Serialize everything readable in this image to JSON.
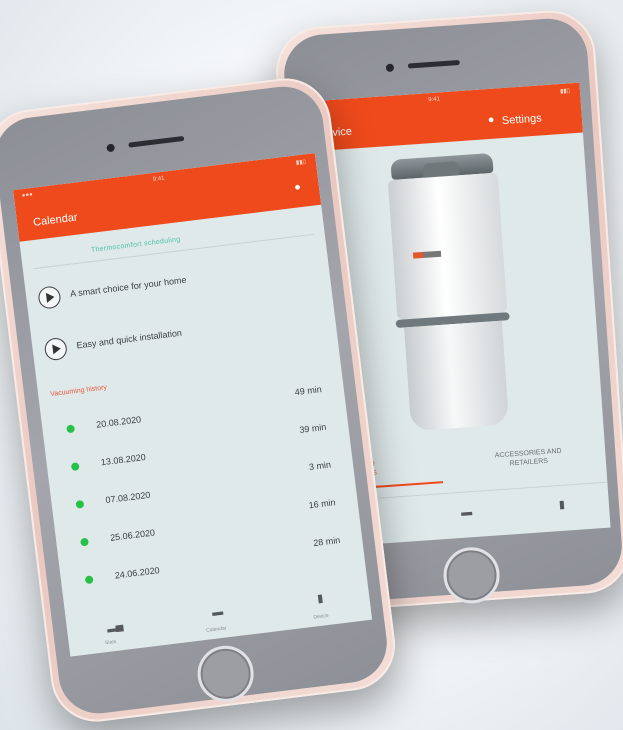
{
  "left_phone": {
    "header": {
      "title": "Calendar",
      "user_icon": "user-icon"
    },
    "section_heading": "Thermocomfort scheduling",
    "features": [
      {
        "label": "A smart choice for your home",
        "icon": "play-icon"
      },
      {
        "label": "Easy and quick installation",
        "icon": "play-icon"
      }
    ],
    "history_heading": "Vacuuming history",
    "history": [
      {
        "date": "20.08.2020",
        "duration": "49 min"
      },
      {
        "date": "13.08.2020",
        "duration": "39 min"
      },
      {
        "date": "07.08.2020",
        "duration": "3 min"
      },
      {
        "date": "25.06.2020",
        "duration": "16 min"
      },
      {
        "date": "24.06.2020",
        "duration": "28 min"
      }
    ],
    "tabs": [
      {
        "icon": "stats-icon",
        "label": "Stats"
      },
      {
        "icon": "calendar-icon",
        "label": "Calendar"
      },
      {
        "icon": "device-icon",
        "label": "Device"
      }
    ]
  },
  "right_phone": {
    "header": {
      "title": "Device",
      "settings_label": "Settings",
      "user_icon": "user-icon"
    },
    "tabs_text": {
      "guides": "GUIDES AND BROCHURES",
      "accessories": "ACCESSORIES AND RETAILERS"
    },
    "bottom_icons": [
      "stats-icon",
      "calendar-icon",
      "device-icon"
    ],
    "product_label": "central vacuum unit"
  },
  "colors": {
    "accent": "#ef4a1c",
    "status_green": "#27c14a",
    "teal_heading": "#4cc3a8",
    "history_heading": "#e85a3a"
  }
}
